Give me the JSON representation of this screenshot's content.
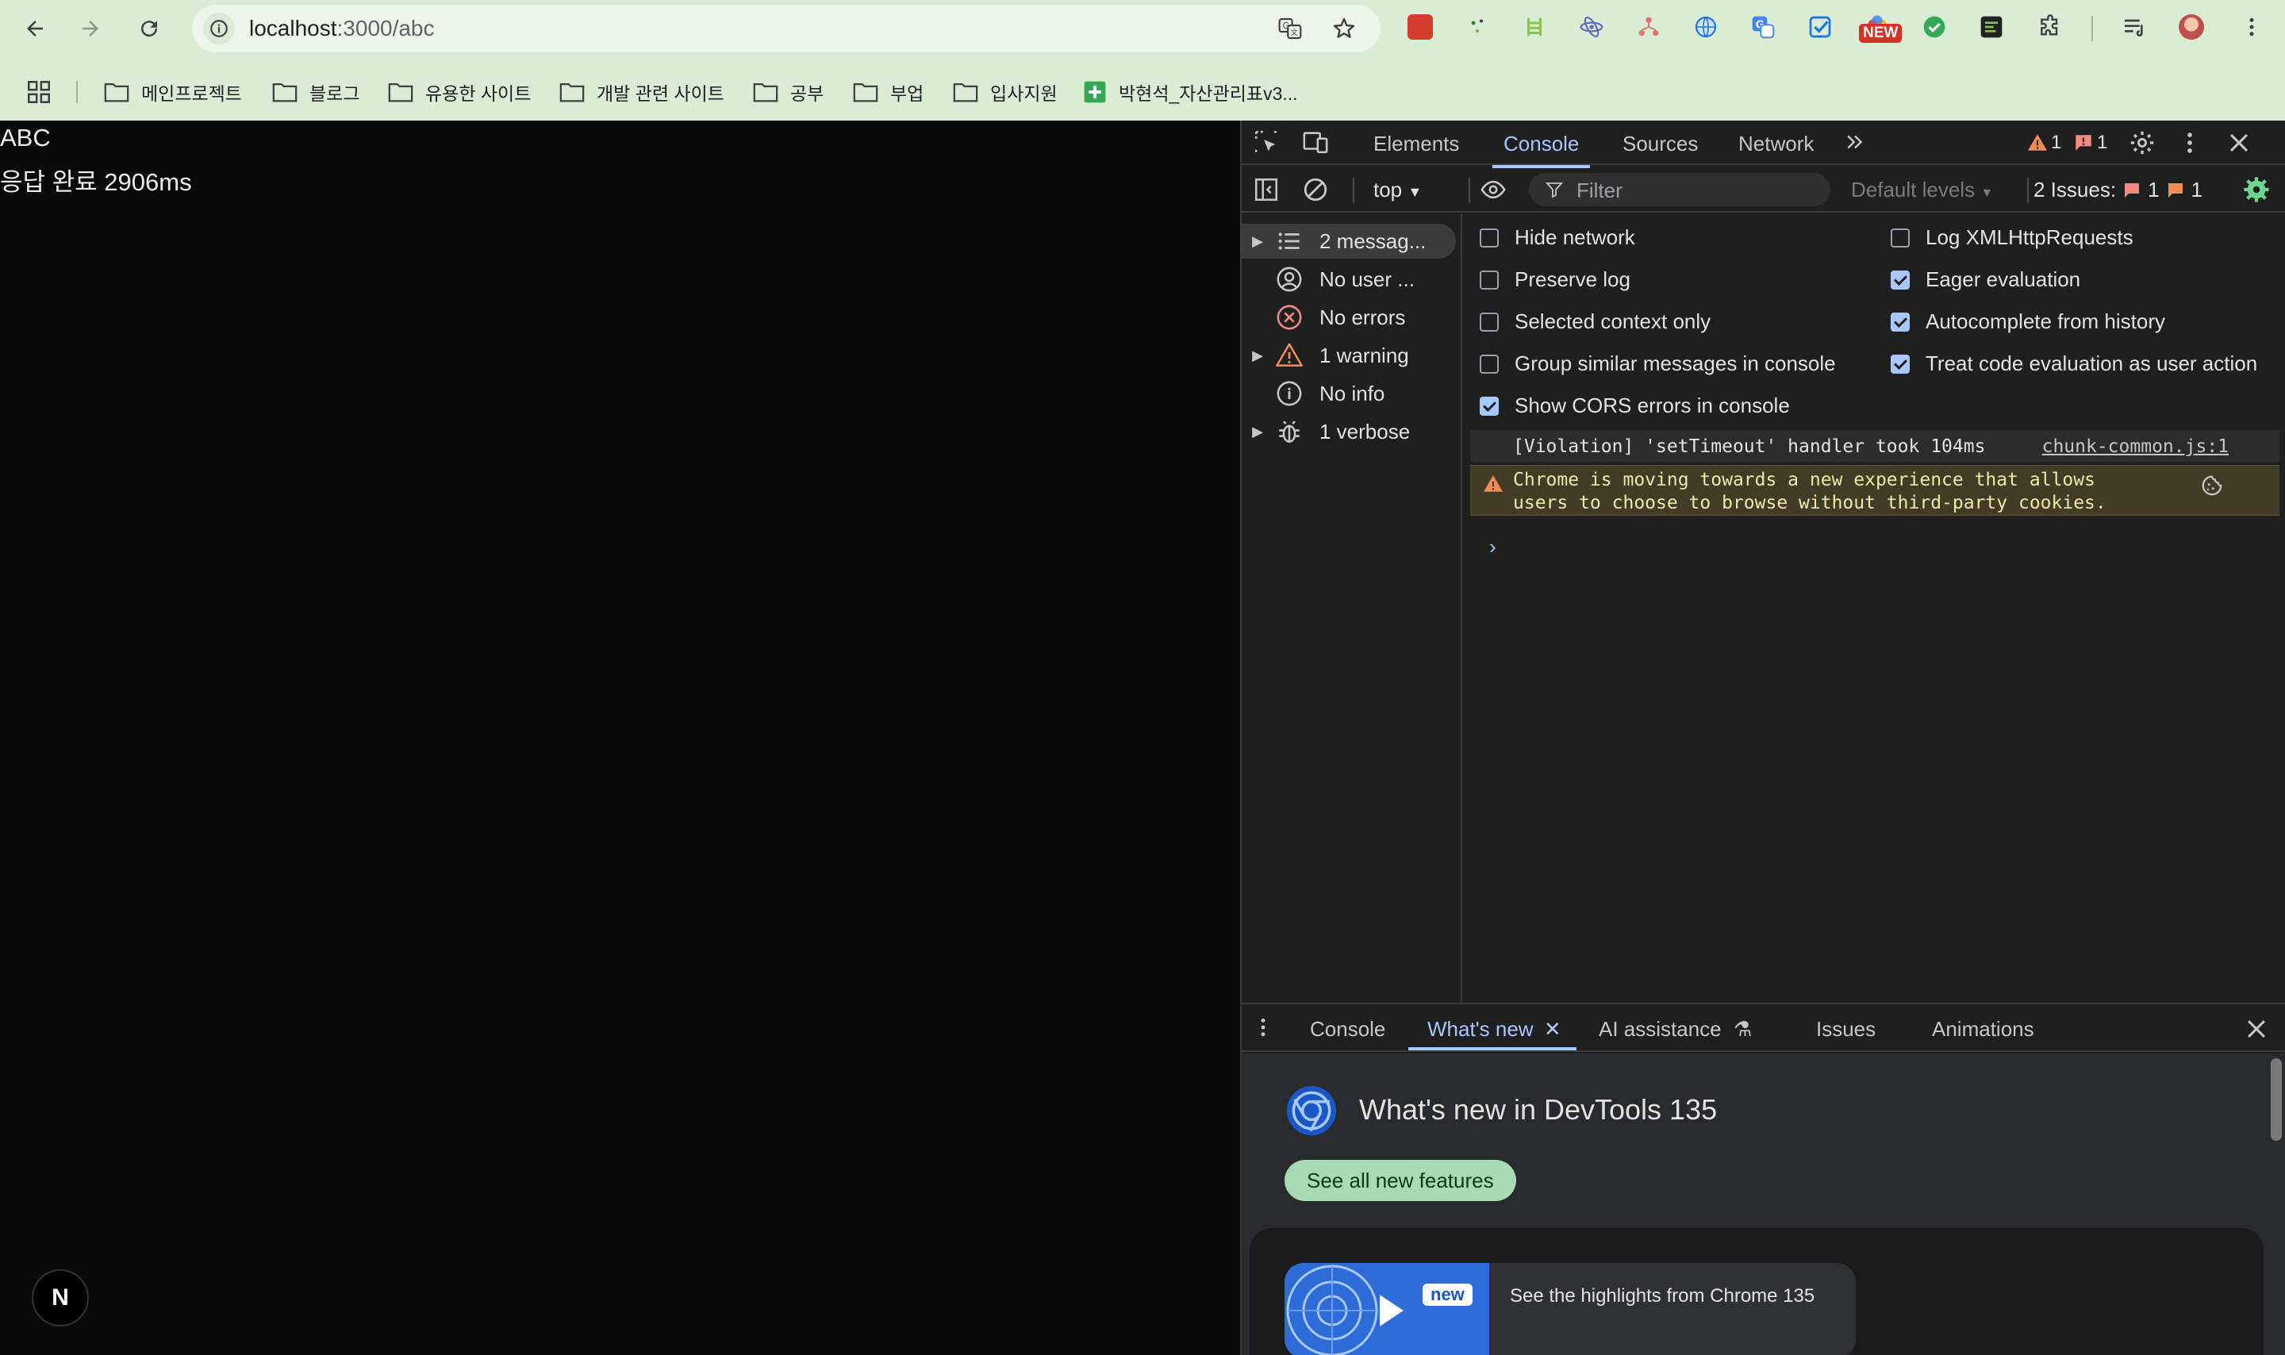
{
  "browser": {
    "url_host": "localhost",
    "url_path": ":3000/abc",
    "extension_new_badge": "NEW",
    "bookmarks": [
      {
        "label": "메인프로젝트"
      },
      {
        "label": "블로그"
      },
      {
        "label": "유용한 사이트"
      },
      {
        "label": "개발 관련 사이트"
      },
      {
        "label": "공부"
      },
      {
        "label": "부업"
      },
      {
        "label": "입사지원"
      },
      {
        "label": "박현석_자산관리표v3..."
      }
    ]
  },
  "page": {
    "line1": "ABC",
    "line2": "응답 완료 2906ms",
    "badge": "N"
  },
  "devtools": {
    "tabs": [
      "Elements",
      "Console",
      "Sources",
      "Network"
    ],
    "active_tab": "Console",
    "warning_count": "1",
    "error_count": "1",
    "toolbar": {
      "context": "top",
      "filter_placeholder": "Filter",
      "levels": "Default levels",
      "issues_label": "2 Issues:",
      "issues_errors": "1",
      "issues_warnings": "1"
    },
    "sidebar": [
      {
        "label": "2 messag...",
        "icon": "list-icon"
      },
      {
        "label": "No user ...",
        "icon": "user-icon"
      },
      {
        "label": "No errors",
        "icon": "error-icon"
      },
      {
        "label": "1 warning",
        "icon": "warning-icon"
      },
      {
        "label": "No info",
        "icon": "info-icon"
      },
      {
        "label": "1 verbose",
        "icon": "bug-icon"
      }
    ],
    "settings_left": [
      {
        "label": "Hide network",
        "checked": false
      },
      {
        "label": "Preserve log",
        "checked": false
      },
      {
        "label": "Selected context only",
        "checked": false
      },
      {
        "label": "Group similar messages in console",
        "checked": false
      },
      {
        "label": "Show CORS errors in console",
        "checked": true
      }
    ],
    "settings_right": [
      {
        "label": "Log XMLHttpRequests",
        "checked": false
      },
      {
        "label": "Eager evaluation",
        "checked": true
      },
      {
        "label": "Autocomplete from history",
        "checked": true
      },
      {
        "label": "Treat code evaluation as user action",
        "checked": true
      }
    ],
    "messages": {
      "violation": "[Violation] 'setTimeout' handler took 104ms",
      "violation_source": "chunk-common.js:1",
      "warning_line1": "Chrome is moving towards a new experience that allows",
      "warning_line2": "users to choose to browse without third-party cookies.",
      "prompt": "›"
    },
    "drawer": {
      "tabs": [
        "Console",
        "What's new",
        "AI assistance",
        "Issues",
        "Animations"
      ],
      "active_tab": "What's new",
      "whats_new_title": "What's new in DevTools 135",
      "see_all": "See all new features",
      "card_badge": "new",
      "card_text": "See the highlights from Chrome 135"
    }
  },
  "colors": {
    "chrome_bg": "#d9ecd4",
    "page_bg": "#0a0a0a",
    "devtools_bg": "#1f1f1f",
    "accent": "#a8c7fa",
    "warning": "#f28b54",
    "error": "#f28b82"
  }
}
